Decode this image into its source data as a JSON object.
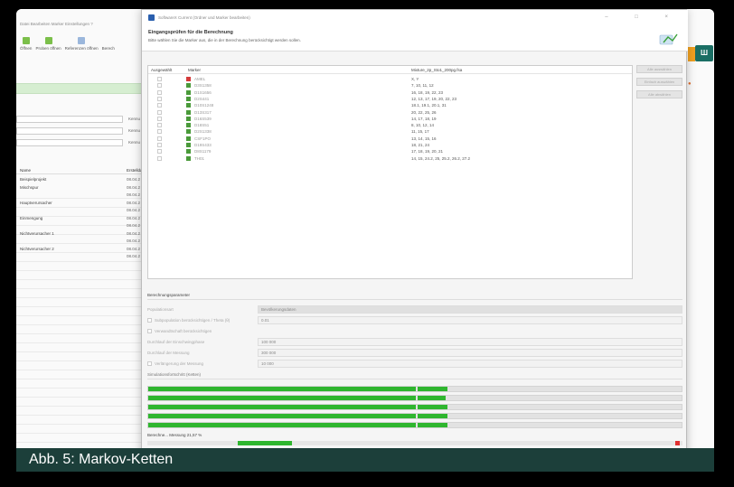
{
  "dialog": {
    "window_title": "SoftwareX Current (Ordner und Marker bearbeiten)",
    "header_title": "Eingangsprüfen für die Berechnung",
    "header_subtitle": "Bitte wählen Sie die Marker aus, die in der Berechnung berücksichtigt werden sollen.",
    "win_controls": "– □ ×"
  },
  "marker_list": {
    "columns": {
      "selected": "Ausgewählt",
      "marker": "Marker",
      "file": "Mixture_2p_Sto1_200pg.fsa"
    },
    "rows": [
      {
        "name": "AMEL",
        "values": "X, Y",
        "color": "#d43a3a"
      },
      {
        "name": "D3S1358",
        "values": "7, 10, 11, 12",
        "color": "#4a9a3a"
      },
      {
        "name": "D1S1656",
        "values": "16, 18, 19, 22, 23",
        "color": "#4a9a3a"
      },
      {
        "name": "D2S441",
        "values": "12, 13, 17, 19, 20, 22, 23",
        "color": "#4a9a3a"
      },
      {
        "name": "D10S1248",
        "values": "18.1, 19.1, 20.1, 31",
        "color": "#4a9a3a"
      },
      {
        "name": "D13S317",
        "values": "20, 22, 25, 26",
        "color": "#4a9a3a"
      },
      {
        "name": "D16S539",
        "values": "14, 17, 18, 19",
        "color": "#4a9a3a"
      },
      {
        "name": "D18S51",
        "values": "8, 10, 12, 14",
        "color": "#4a9a3a"
      },
      {
        "name": "D2S1338",
        "values": "11, 15, 17",
        "color": "#4a9a3a"
      },
      {
        "name": "CSF1PO",
        "values": "13, 14, 15, 16",
        "color": "#4a9a3a"
      },
      {
        "name": "D19S433",
        "values": "18, 21, 24",
        "color": "#4a9a3a"
      },
      {
        "name": "D8S1179",
        "values": "17, 18, 19, 20, 21",
        "color": "#4a9a3a"
      },
      {
        "name": "TH01",
        "values": "14, 15, 24.2, 25, 25.2, 26.2, 27.2",
        "color": "#4a9a3a"
      }
    ]
  },
  "side_buttons": [
    "Alle auswählen",
    "Einfach auswählen",
    "Alle abwählen"
  ],
  "params": {
    "title": "Berechnungsparameter",
    "rows": [
      {
        "label": "Populationsart",
        "value": "Bevölkerungsdaten",
        "checkbox": false,
        "select": true
      },
      {
        "label": "Subpopulation berücksichtigen / Theta (θ)",
        "value": "0.01",
        "checkbox": true,
        "select": false
      },
      {
        "label": "Verwandtschaft berücksichtigen",
        "value": "",
        "checkbox": true,
        "select": false,
        "no_field": true
      },
      {
        "label": "Durchlauf der Einschwingphase",
        "value": "100 000",
        "checkbox": false,
        "select": false
      },
      {
        "label": "Durchlauf der Messung",
        "value": "300 000",
        "checkbox": false,
        "select": false
      },
      {
        "label": "Verlängerung der Messung",
        "value": "10 000",
        "checkbox": true,
        "select": false
      }
    ]
  },
  "simulation": {
    "title": "Simulationsfortschritt (Ketten)",
    "chains": [
      {
        "first": 1.0,
        "second": 0.11
      },
      {
        "first": 1.0,
        "second": 0.105
      },
      {
        "first": 1.0,
        "second": 0.11
      },
      {
        "first": 1.0,
        "second": 0.11
      },
      {
        "first": 1.0,
        "second": 0.11
      }
    ],
    "first_segment_share": 0.5,
    "second_segment_share": 0.5
  },
  "status": {
    "text": "Berechne... Messung 21,57 %",
    "progress": 0.2157
  },
  "background_app": {
    "menu": "Datei  Bearbeiten  Marker  Einstellungen  ?",
    "toolbar": [
      "Öffnen",
      "Proben öffnen",
      "Referenzen öffnen",
      "Berech"
    ],
    "field_labels": [
      "Kennu",
      "Kennu",
      "Kennu"
    ],
    "table_headers": {
      "name": "Name",
      "date": "Erstelldatum"
    },
    "rows": [
      {
        "name": "Beispielprojekt",
        "date": "08.04.2"
      },
      {
        "name": "Mischspur",
        "date": "08.04.2"
      },
      {
        "name": "",
        "date": "08.04.2"
      },
      {
        "name": "Hauptverursacher",
        "date": "08.04.2"
      },
      {
        "name": "",
        "date": "08.04.2"
      },
      {
        "name": "Einmengung",
        "date": "08.04.2"
      },
      {
        "name": "",
        "date": "08.04.2"
      },
      {
        "name": "Nichtverursacher 1",
        "date": "08.04.2"
      },
      {
        "name": "",
        "date": "08.04.2"
      },
      {
        "name": "Nichtverursacher 2",
        "date": "08.04.2"
      },
      {
        "name": "",
        "date": "08.04.2"
      }
    ],
    "right_badge": "Ш"
  },
  "caption": "Abb. 5: Markov-Ketten"
}
